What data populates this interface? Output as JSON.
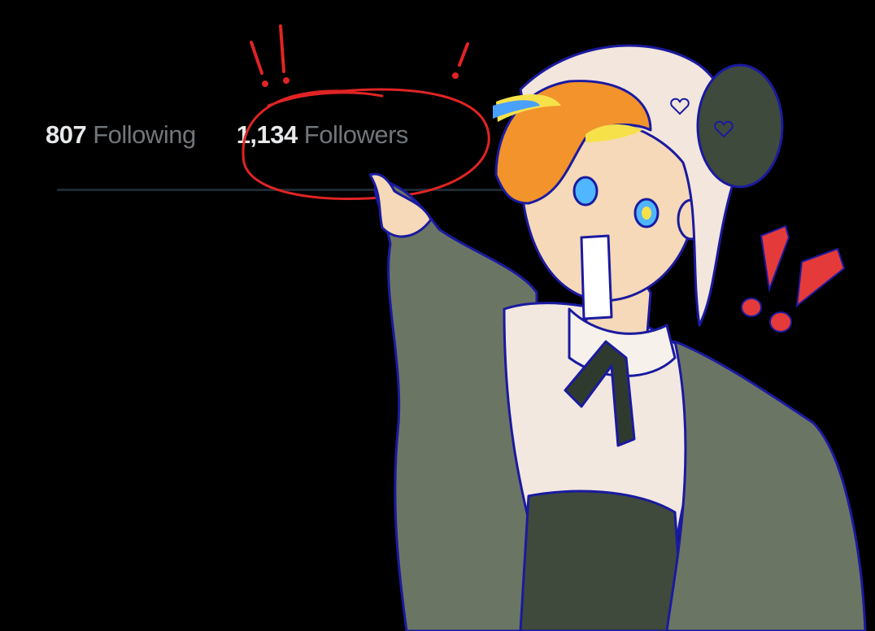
{
  "profile_stats": {
    "following": {
      "count": "807",
      "label": "Following"
    },
    "followers": {
      "count": "1,134",
      "label": "Followers"
    }
  },
  "colors": {
    "background": "#000000",
    "count_text": "#e7e9ea",
    "label_text": "#71767b",
    "annotation_red": "#e02424",
    "outline_blue": "#1a1aa0"
  },
  "illustration": {
    "subject": "drawn character pointing at follower count",
    "icons": [
      "exclamation-marks-icon",
      "heart-icon"
    ]
  }
}
